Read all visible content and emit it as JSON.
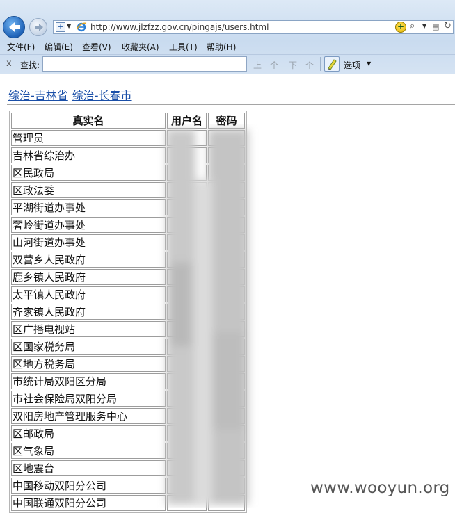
{
  "browser": {
    "url": "http://www.jlzfzz.gov.cn/pingajs/users.html",
    "menu": [
      "文件(F)",
      "编辑(E)",
      "查看(V)",
      "收藏夹(A)",
      "工具(T)",
      "帮助(H)"
    ],
    "find": {
      "close": "x",
      "label": "查找:",
      "value": "",
      "prev": "上一个",
      "next": "下一个",
      "options": "选项"
    }
  },
  "page": {
    "breadcrumbs": [
      "综治-吉林省",
      "综治-长春市"
    ],
    "table": {
      "headers": [
        "真实名",
        "用户名",
        "密码"
      ],
      "rows": [
        "管理员",
        "吉林省综治办",
        "区民政局",
        "区政法委",
        "平湖街道办事处",
        "奢岭街道办事处",
        "山河街道办事处",
        "双营乡人民政府",
        "鹿乡镇人民政府",
        "太平镇人民政府",
        "齐家镇人民政府",
        "区广播电视站",
        "区国家税务局",
        "区地方税务局",
        "市统计局双阳区分局",
        "市社会保险局双阳分局",
        "双阳房地产管理服务中心",
        "区邮政局",
        "区气象局",
        "区地震台",
        "中国移动双阳分公司",
        "中国联通双阳分公司"
      ]
    }
  },
  "watermark": "www.wooyun.org"
}
